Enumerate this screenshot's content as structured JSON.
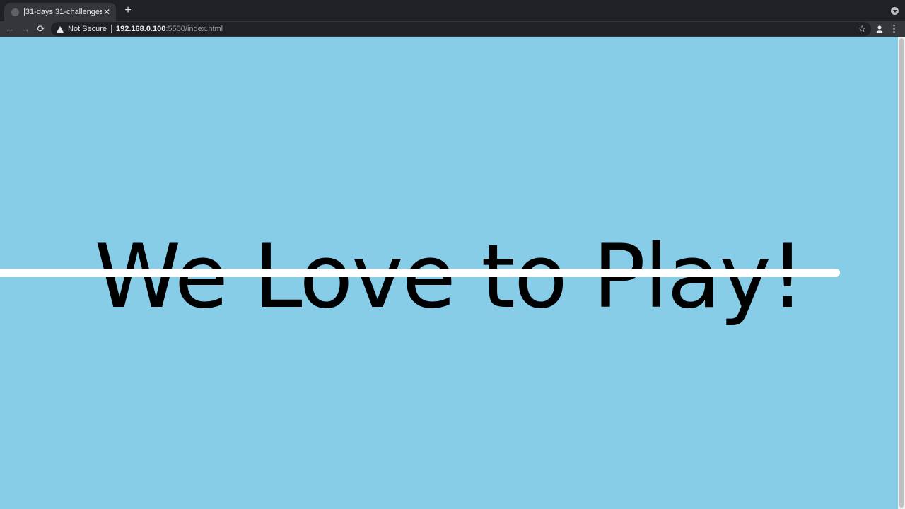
{
  "tab": {
    "title": "|31-days 31-challenges",
    "close": "✕"
  },
  "new_tab": "+",
  "nav": {
    "back": "←",
    "forward": "→",
    "reload": "⟳"
  },
  "omnibox": {
    "security": "Not Secure",
    "host": "192.168.0.100",
    "rest": ":5500/index.html"
  },
  "toolbar_icons": {
    "bookmark": "☆",
    "menu": "⋮"
  },
  "page": {
    "headline": "We Love to Play!",
    "background": "#87cde8",
    "line_color": "#ffffff"
  }
}
